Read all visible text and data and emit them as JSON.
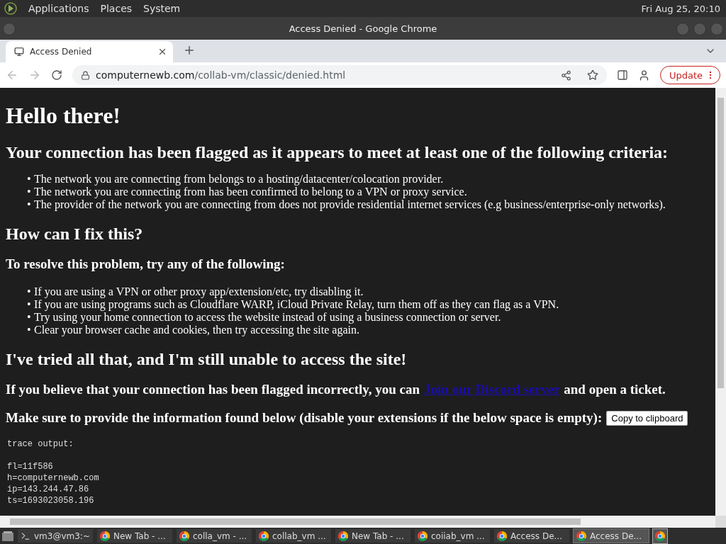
{
  "top_panel": {
    "menus": [
      "Applications",
      "Places",
      "System"
    ],
    "clock": "Fri Aug 25, 20:10"
  },
  "window": {
    "title": "Access Denied - Google Chrome"
  },
  "tabs": [
    {
      "label": "Access Denied",
      "selected": true
    }
  ],
  "address_bar": {
    "domain": "computernewb.com",
    "path": "/collab-vm/classic/denied.html",
    "update_button": "Update"
  },
  "page": {
    "heading": "Hello there!",
    "criteria_heading": "Your connection has been flagged as it appears to meet at least one of the following criteria:",
    "criteria": [
      {
        "marker": "•",
        "text": "The network you are connecting from belongs to a hosting/datacenter/colocation provider."
      },
      {
        "marker": "•",
        "text": "The network you are connecting from has been confirmed to belong to a VPN or proxy service."
      },
      {
        "marker": "•",
        "text": "The provider of the network you are connecting from does not provide residential internet services (e.g business/enterprise-only networks)."
      }
    ],
    "fix_heading": "How can I fix this?",
    "fix_subheading": "To resolve this problem, try any of the following:",
    "fixes": [
      {
        "marker": "•",
        "text": "If you are using a VPN or other proxy app/extension/etc, try disabling it."
      },
      {
        "marker": "•",
        "text": "If you are using programs such as Cloudflare WARP, iCloud Private Relay, turn them off as they can flag as a VPN."
      },
      {
        "marker": "•",
        "text": "Try using your home connection to access the website instead of using a business connection or server."
      },
      {
        "marker": "•",
        "text": "Clear your browser cache and cookies, then try accessing the site again."
      }
    ],
    "tried_heading": "I've tried all that, and I'm still unable to access the site!",
    "incorrect_before": "If you believe that your connection has been flagged incorrectly, you can",
    "discord_link": "Join our Discord server",
    "incorrect_after": "and open a ticket.",
    "provide_text": "Make sure to provide the information found below (disable your extensions if the below space is empty):",
    "copy_button": "Copy to clipboard",
    "trace_header": "trace output:",
    "trace": [
      "fl=11f586",
      "h=computernewb.com",
      "ip=143.244.47.86",
      "ts=1693023058.196"
    ]
  },
  "taskbar": [
    {
      "kind": "terminal",
      "label": "vm3@vm3:~",
      "selected": false
    },
    {
      "kind": "browser",
      "label": "New Tab - ...",
      "selected": false
    },
    {
      "kind": "browser",
      "label": "colla_vm - ...",
      "selected": false
    },
    {
      "kind": "browser",
      "label": "collab_vm ...",
      "selected": false
    },
    {
      "kind": "browser",
      "label": "New Tab - ...",
      "selected": false
    },
    {
      "kind": "browser",
      "label": "coiiab_vm ...",
      "selected": false
    },
    {
      "kind": "browser",
      "label": "Access De...",
      "selected": false
    },
    {
      "kind": "browser",
      "label": "Access De...",
      "selected": true
    }
  ]
}
